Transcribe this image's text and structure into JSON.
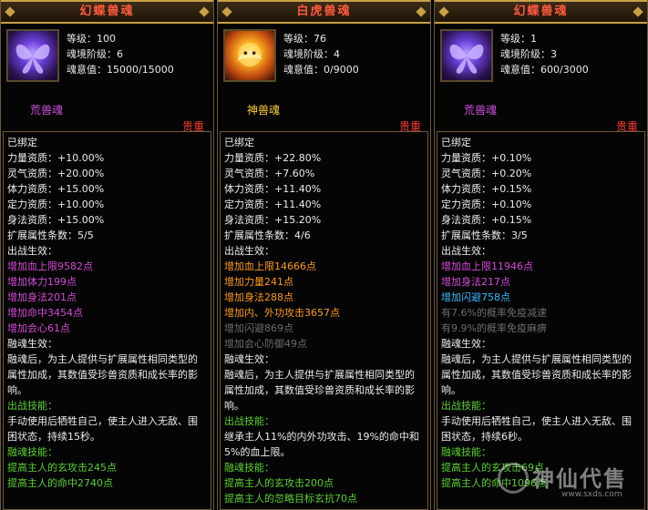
{
  "panels": [
    {
      "title": "幻蝶兽魂",
      "stats": [
        "等级：100",
        "魂境阶级：6",
        "魂意值：15000/15000"
      ],
      "rarity": "荒兽魂",
      "precious": "贵重",
      "bound": "已绑定",
      "attrs": [
        "力量资质：+10.00%",
        "灵气资质：+20.00%",
        "体力资质：+15.00%",
        "定力资质：+10.00%",
        "身法资质：+15.00%"
      ],
      "expand": "扩展属性条数：5/5",
      "battle_label": "出战生效：",
      "battle_effects": [
        {
          "text": "增加血上限9582点",
          "color": "pink"
        },
        {
          "text": "增加体力199点",
          "color": "pink"
        },
        {
          "text": "增加身法201点",
          "color": "pink"
        },
        {
          "text": "增加命中3454点",
          "color": "pink"
        },
        {
          "text": "增加会心61点",
          "color": "pink"
        }
      ],
      "fuse_label": "融魂生效：",
      "fuse_desc": "融魂后，为主人提供与扩展属性相同类型的属性加成，其数值受珍兽资质和成长率的影响。",
      "battle_skill_label": "出战技能：",
      "battle_skill_desc": "手动使用后牺牲自己，使主人进入无敌、围困状态，持续15秒。",
      "fuse_skill_label": "融魂技能：",
      "fuse_skills": [
        "提高主人的玄攻击245点",
        "提高主人的命中2740点"
      ]
    },
    {
      "title": "白虎兽魂",
      "stats": [
        "等级：76",
        "魂境阶级：4",
        "魂意值：0/9000"
      ],
      "rarity": "神兽魂",
      "precious": "贵重",
      "bound": "已绑定",
      "attrs": [
        "力量资质：+22.80%",
        "灵气资质：+7.60%",
        "体力资质：+11.40%",
        "定力资质：+11.40%",
        "身法资质：+15.20%"
      ],
      "expand": "扩展属性条数：4/6",
      "battle_label": "出战生效：",
      "battle_effects": [
        {
          "text": "增加血上限14666点",
          "color": "orange"
        },
        {
          "text": "增加力量241点",
          "color": "orange"
        },
        {
          "text": "增加身法288点",
          "color": "orange"
        },
        {
          "text": "增加内、外功攻击3657点",
          "color": "orange"
        },
        {
          "text": "增加闪避869点",
          "color": "gray"
        },
        {
          "text": "增加会心防御49点",
          "color": "gray"
        }
      ],
      "fuse_label": "融魂生效：",
      "fuse_desc": "融魂后，为主人提供与扩展属性相同类型的属性加成，其数值受珍兽资质和成长率的影响。",
      "battle_skill_label": "出战技能：",
      "battle_skill_desc": "继承主人11%的内外功攻击、19%的命中和5%的血上限。",
      "fuse_skill_label": "融魂技能：",
      "fuse_skills": [
        "提高主人的玄攻击200点",
        "提高主人的忽略目标玄抗70点"
      ]
    },
    {
      "title": "幻蝶兽魂",
      "stats": [
        "等级：1",
        "魂境阶级：3",
        "魂意值：600/3000"
      ],
      "rarity": "荒兽魂",
      "precious": "贵重",
      "bound": "已绑定",
      "attrs": [
        "力量资质：+0.10%",
        "灵气资质：+0.20%",
        "体力资质：+0.15%",
        "定力资质：+0.10%",
        "身法资质：+0.15%"
      ],
      "expand": "扩展属性条数：3/5",
      "battle_label": "出战生效：",
      "battle_effects": [
        {
          "text": "增加血上限11946点",
          "color": "pink"
        },
        {
          "text": "增加身法217点",
          "color": "pink"
        },
        {
          "text": "增加闪避758点",
          "color": "cyan"
        },
        {
          "text": "有7.6%的概率免疫减速",
          "color": "gray"
        },
        {
          "text": "有9.9%的概率免疫麻痹",
          "color": "gray"
        }
      ],
      "fuse_label": "融魂生效：",
      "fuse_desc": "融魂后，为主人提供与扩展属性相同类型的属性加成，其数值受珍兽资质和成长率的影响。",
      "battle_skill_label": "出战技能：",
      "battle_skill_desc": "手动使用后牺牲自己，使主人进入无敌、围困状态，持续6秒。",
      "fuse_skill_label": "融魂技能：",
      "fuse_skills": [
        "提高主人的玄攻击69点",
        "提高主人的命中1096点"
      ]
    }
  ],
  "watermark": {
    "text": "神仙代售",
    "url": "www.sxds.com"
  }
}
